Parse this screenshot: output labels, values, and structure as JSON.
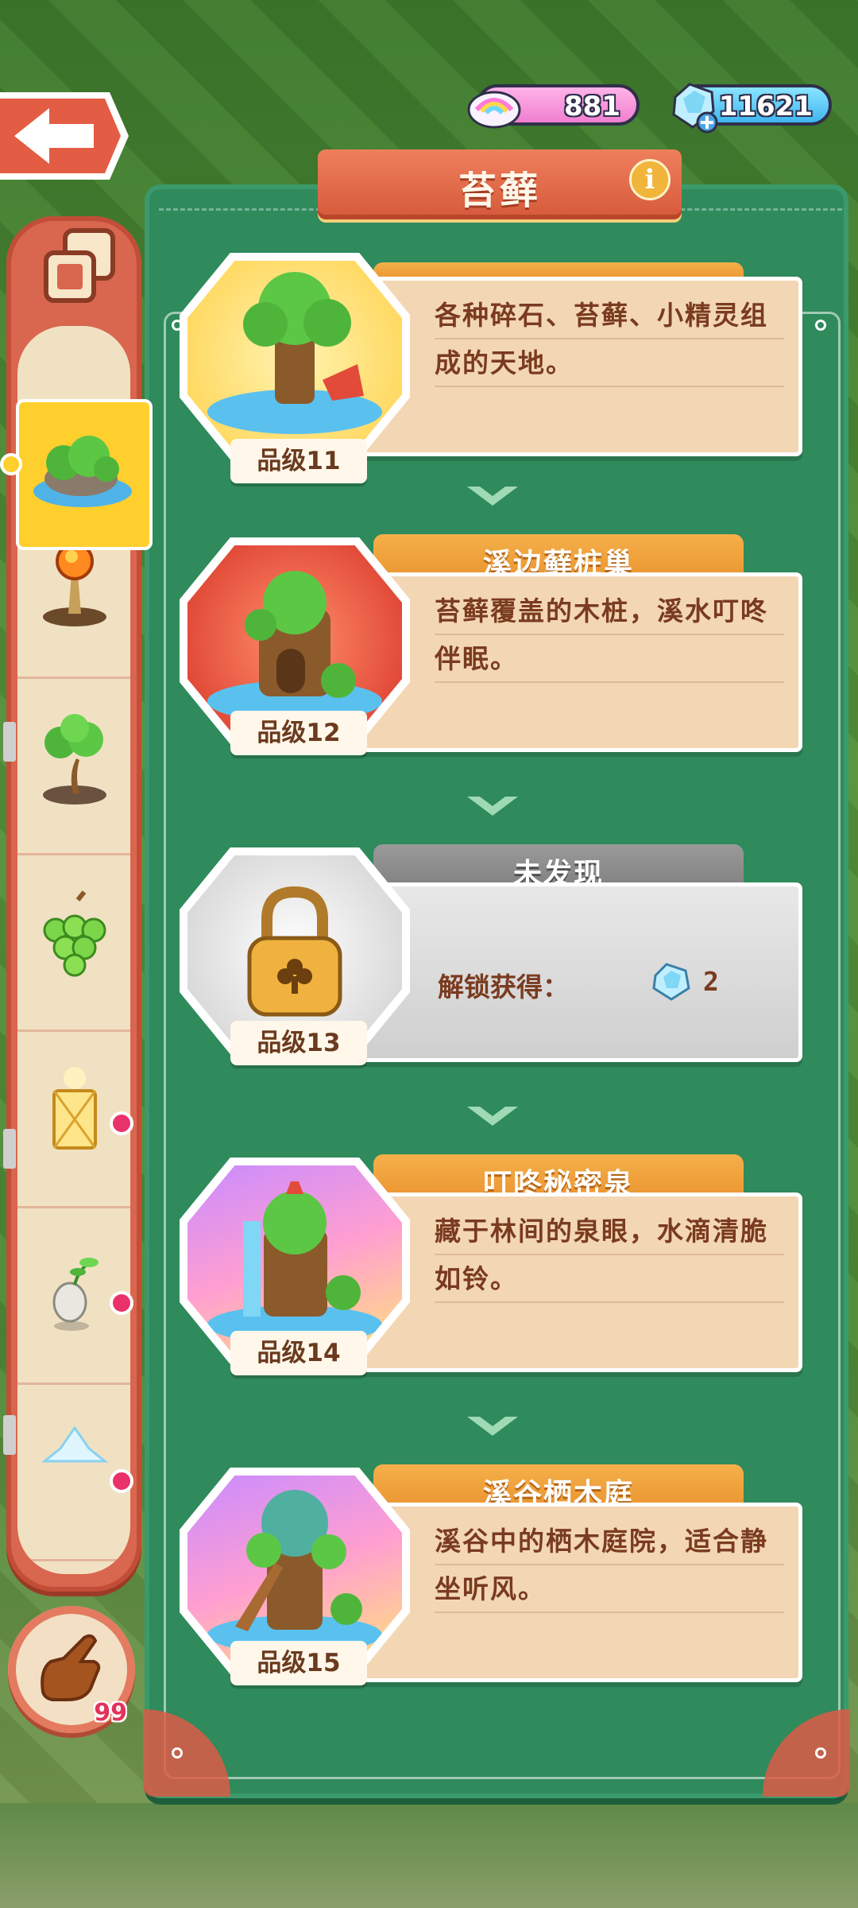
{
  "header": {
    "back_icon": "back-arrow-icon",
    "currency_pink": {
      "icon": "rainbow-cloud-icon",
      "value": "881"
    },
    "currency_blue": {
      "icon": "diamond-plus-icon",
      "value": "11621"
    }
  },
  "panel": {
    "title": "苔藓",
    "info_label": "i"
  },
  "sidebar": {
    "collection_icon": "stack-collection-icon",
    "items": [
      {
        "name": "moss-island",
        "selected": true,
        "dot": false
      },
      {
        "name": "torch-sprout",
        "selected": false,
        "dot": false
      },
      {
        "name": "bonsai-tree",
        "selected": false,
        "dot": false
      },
      {
        "name": "grape-bunch",
        "selected": false,
        "dot": true
      },
      {
        "name": "golden-lantern",
        "selected": false,
        "dot": true
      },
      {
        "name": "seed-egg",
        "selected": false,
        "dot": true
      }
    ],
    "hand_count": "99"
  },
  "entries": [
    {
      "name": "",
      "desc": "各种碎石、苔藓、小精灵组成的天地。",
      "grade": "品级11",
      "theme": "yellow"
    },
    {
      "name": "溪边藓桩巢",
      "desc": "苔藓覆盖的木桩，溪水叮咚伴眠。",
      "grade": "品级12",
      "theme": "red"
    },
    {
      "name": "未发现",
      "unlock_label": "解锁获得：",
      "unlock_value": "2",
      "grade": "品级13",
      "theme": "grey"
    },
    {
      "name": "叮咚秘密泉",
      "desc": "藏于林间的泉眼，水滴清脆如铃。",
      "grade": "品级14",
      "theme": "rainbow"
    },
    {
      "name": "溪谷栖木庭",
      "desc": "溪谷中的栖木庭院，适合静坐听风。",
      "grade": "品级15",
      "theme": "rainbow"
    }
  ],
  "colors": {
    "panel_green": "#2f8a5c",
    "title_red": "#d75c3d",
    "tab_orange": "#e88e2a",
    "card_beige": "#f3d7b4",
    "text_brown": "#7a3b20",
    "sidebar_red": "#d9664e",
    "selected_yellow": "#ffcf2e",
    "badge_pink": "#e9316a"
  }
}
